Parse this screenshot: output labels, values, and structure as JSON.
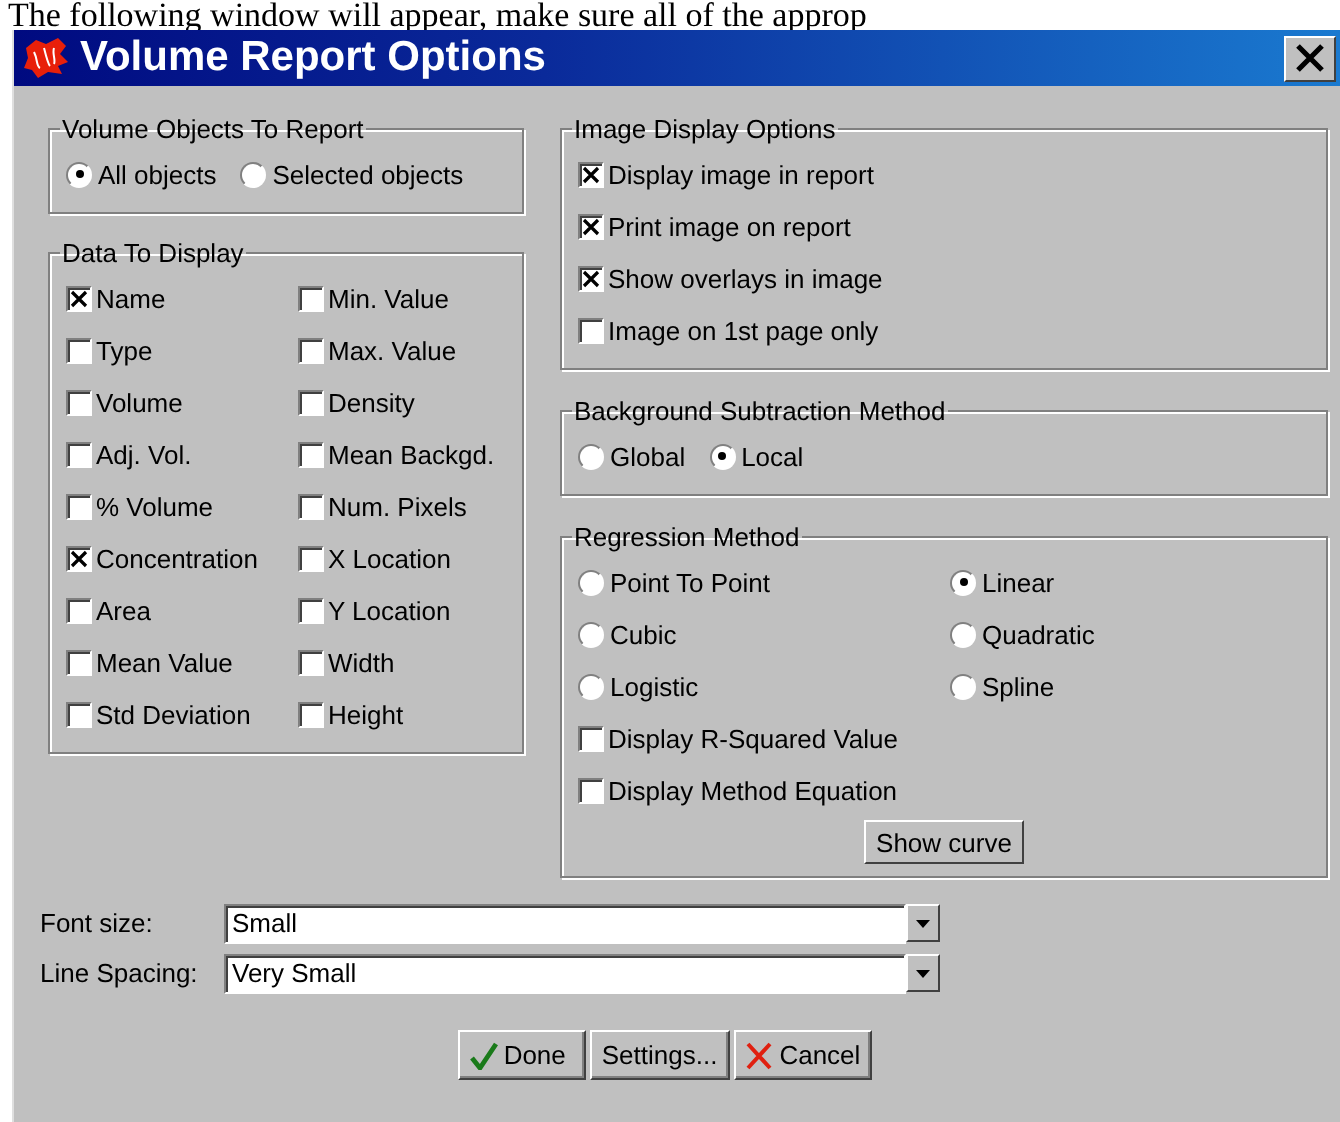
{
  "document_text": "The following window will appear, make sure all of the approp",
  "window": {
    "title": "Volume Report Options"
  },
  "volume_objects": {
    "title": "Volume Objects To Report",
    "options": [
      {
        "label": "All objects",
        "selected": true
      },
      {
        "label": "Selected objects",
        "selected": false
      }
    ]
  },
  "data_to_display": {
    "title": "Data To Display",
    "columns": [
      [
        {
          "label": "Name",
          "checked": true
        },
        {
          "label": "Type",
          "checked": false
        },
        {
          "label": "Volume",
          "checked": false
        },
        {
          "label": "Adj. Vol.",
          "checked": false
        },
        {
          "label": "% Volume",
          "checked": false
        },
        {
          "label": "Concentration",
          "checked": true
        },
        {
          "label": "Area",
          "checked": false
        },
        {
          "label": "Mean Value",
          "checked": false
        },
        {
          "label": "Std Deviation",
          "checked": false
        }
      ],
      [
        {
          "label": "Min. Value",
          "checked": false
        },
        {
          "label": "Max. Value",
          "checked": false
        },
        {
          "label": "Density",
          "checked": false
        },
        {
          "label": "Mean Backgd.",
          "checked": false
        },
        {
          "label": "Num. Pixels",
          "checked": false
        },
        {
          "label": "X Location",
          "checked": false
        },
        {
          "label": "Y Location",
          "checked": false
        },
        {
          "label": "Width",
          "checked": false
        },
        {
          "label": "Height",
          "checked": false
        }
      ]
    ]
  },
  "image_display_options": {
    "title": "Image Display Options",
    "items": [
      {
        "label": "Display image in report",
        "checked": true
      },
      {
        "label": "Print image on report",
        "checked": true
      },
      {
        "label": "Show overlays in image",
        "checked": true
      },
      {
        "label": "Image on 1st page only",
        "checked": false
      }
    ]
  },
  "background_subtraction": {
    "title": "Background Subtraction Method",
    "options": [
      {
        "label": "Global",
        "selected": false
      },
      {
        "label": "Local",
        "selected": true
      }
    ]
  },
  "regression_method": {
    "title": "Regression Method",
    "options": [
      {
        "label": "Point To Point",
        "selected": false
      },
      {
        "label": "Linear",
        "selected": true
      },
      {
        "label": "Cubic",
        "selected": false
      },
      {
        "label": "Quadratic",
        "selected": false
      },
      {
        "label": "Logistic",
        "selected": false
      },
      {
        "label": "Spline",
        "selected": false
      }
    ],
    "checks": [
      {
        "label": "Display R-Squared Value",
        "checked": false
      },
      {
        "label": "Display Method Equation",
        "checked": false
      }
    ],
    "button": "Show curve"
  },
  "font_size": {
    "label": "Font size:",
    "value": "Small"
  },
  "line_spacing": {
    "label": "Line Spacing:",
    "value": "Very Small"
  },
  "buttons": [
    {
      "label": "Done",
      "kind": "done"
    },
    {
      "label": "Settings...",
      "kind": "plain"
    },
    {
      "label": "Cancel",
      "kind": "cancel"
    }
  ]
}
